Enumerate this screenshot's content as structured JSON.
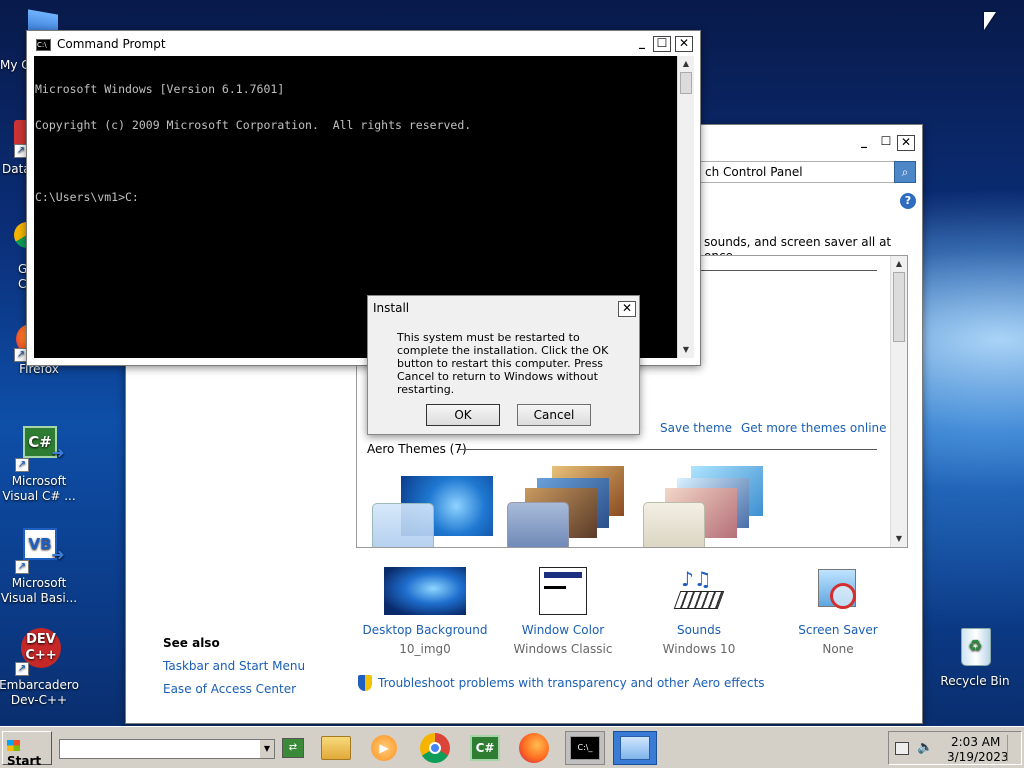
{
  "desktop": {
    "icons": [
      {
        "label": "My C"
      },
      {
        "label": "Data"
      },
      {
        "label": "G\nC"
      },
      {
        "label": "Firefox"
      },
      {
        "label": "Microsoft\nVisual C# ..."
      },
      {
        "label": "Microsoft\nVisual Basi..."
      },
      {
        "label": "Embarcadero\nDev-C++"
      },
      {
        "label": "Recycle Bin"
      }
    ]
  },
  "personalization": {
    "search_placeholder": "ch Control Panel",
    "subtitle_fragment": "sounds, and screen saver all at once.",
    "save_theme": "Save theme",
    "get_more": "Get more themes online",
    "aero_header": "Aero Themes (7)",
    "items": [
      {
        "label": "Desktop Background",
        "value": "10_img0"
      },
      {
        "label": "Window Color",
        "value": "Windows Classic"
      },
      {
        "label": "Sounds",
        "value": "Windows 10"
      },
      {
        "label": "Screen Saver",
        "value": "None"
      }
    ],
    "see_also": {
      "title": "See also",
      "links": [
        "Taskbar and Start Menu",
        "Ease of Access Center"
      ]
    },
    "troubleshoot": "Troubleshoot problems with transparency and other Aero effects"
  },
  "cmd": {
    "title": "Command Prompt",
    "lines": [
      "Microsoft Windows [Version 6.1.7601]",
      "Copyright (c) 2009 Microsoft Corporation.  All rights reserved.",
      "",
      "C:\\Users\\vm1>C:"
    ]
  },
  "install": {
    "title": "Install",
    "message": "This system must be restarted to complete the installation. Click the OK button to restart this computer. Press Cancel to return to Windows without restarting.",
    "ok": "OK",
    "cancel": "Cancel"
  },
  "taskbar": {
    "start": "Start",
    "time": "2:03 AM",
    "date": "3/19/2023"
  },
  "colors": {
    "link": "#1a5fb4",
    "cmd_bg": "#000000",
    "taskbar": "#d4d0c8"
  }
}
